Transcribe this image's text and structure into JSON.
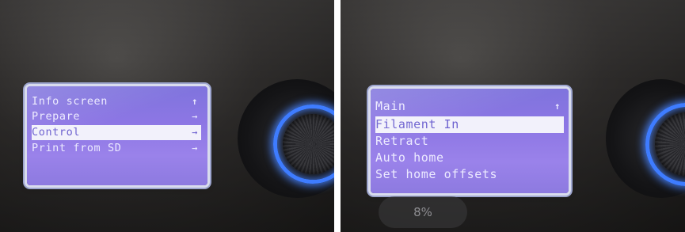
{
  "left_display": {
    "menu": [
      {
        "label": "Info screen",
        "glyph": "↑",
        "selected": false
      },
      {
        "label": "Prepare",
        "glyph": "→",
        "selected": false
      },
      {
        "label": "Control",
        "glyph": "→",
        "selected": true
      },
      {
        "label": "Print from SD",
        "glyph": "→",
        "selected": false
      }
    ]
  },
  "right_display": {
    "menu": [
      {
        "label": "Main",
        "glyph": "↑",
        "selected": false
      },
      {
        "label": "Filament In",
        "glyph": "",
        "selected": true
      },
      {
        "label": "Retract",
        "glyph": "",
        "selected": false
      },
      {
        "label": "Auto home",
        "glyph": "",
        "selected": false
      },
      {
        "label": "Set home offsets",
        "glyph": "",
        "selected": false
      }
    ]
  },
  "overlay": {
    "progress_text": "8%"
  },
  "colors": {
    "lcd_background": "#8a78e2",
    "lcd_text": "#eceaff",
    "selection_bar": "#f2f1fb",
    "knob_glow": "#3e7cff"
  }
}
